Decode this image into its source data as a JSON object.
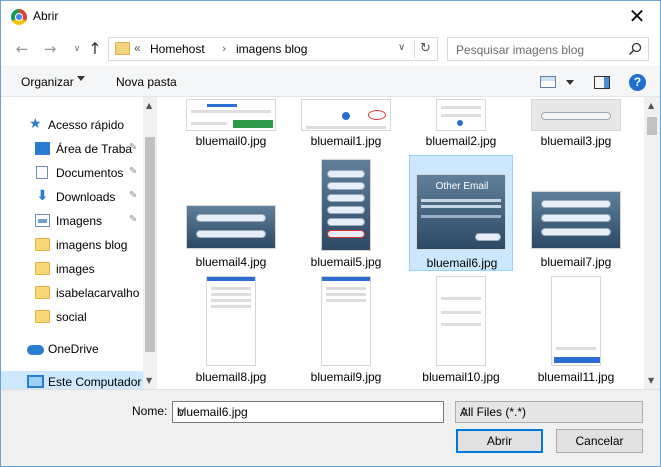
{
  "window": {
    "title": "Abrir",
    "close_glyph": "✕"
  },
  "nav": {
    "back_glyph": "←",
    "forward_glyph": "→",
    "recent_glyph": "∨",
    "up_glyph": "↑",
    "breadcrumb_prefix": "«",
    "breadcrumb": [
      "Homehost",
      "imagens blog"
    ],
    "breadcrumb_sep": "›",
    "dropdown_glyph": "∨",
    "refresh_glyph": "↻",
    "search_placeholder": "Pesquisar imagens blog"
  },
  "toolbar": {
    "organize": "Organizar",
    "new_folder": "Nova pasta",
    "help": "?"
  },
  "sidebar": {
    "items": [
      {
        "label": "Acesso rápido",
        "icon": "star-icon"
      },
      {
        "label": "Área de Traba",
        "icon": "desktop-icon",
        "pinned": true
      },
      {
        "label": "Documentos",
        "icon": "document-icon",
        "pinned": true
      },
      {
        "label": "Downloads",
        "icon": "download-icon",
        "pinned": true
      },
      {
        "label": "Imagens",
        "icon": "pictures-icon",
        "pinned": true
      },
      {
        "label": "imagens blog",
        "icon": "folder-icon"
      },
      {
        "label": "images",
        "icon": "folder-icon"
      },
      {
        "label": "isabelacarvalho",
        "icon": "folder-icon"
      },
      {
        "label": "social",
        "icon": "folder-icon"
      },
      {
        "label": "OneDrive",
        "icon": "cloud-icon"
      },
      {
        "label": "Este Computador",
        "icon": "computer-icon",
        "selected": true
      }
    ],
    "pin_glyph": "📌",
    "expand_glyph": "∨"
  },
  "files": [
    {
      "name": "bluemail0.jpg"
    },
    {
      "name": "bluemail1.jpg"
    },
    {
      "name": "bluemail2.jpg"
    },
    {
      "name": "bluemail3.jpg"
    },
    {
      "name": "bluemail4.jpg"
    },
    {
      "name": "bluemail5.jpg"
    },
    {
      "name": "bluemail6.jpg",
      "selected": true,
      "thumb_title": "Other Email"
    },
    {
      "name": "bluemail7.jpg"
    },
    {
      "name": "bluemail8.jpg"
    },
    {
      "name": "bluemail9.jpg"
    },
    {
      "name": "bluemail10.jpg"
    },
    {
      "name": "bluemail11.jpg"
    }
  ],
  "footer": {
    "name_label": "Nome:",
    "name_value": "bluemail6.jpg",
    "filter_value": "All Files (*.*)",
    "open_label": "Abrir",
    "cancel_label": "Cancelar"
  },
  "colors": {
    "accent": "#0078d7",
    "selection": "#cce8ff",
    "folder": "#f8d775"
  }
}
